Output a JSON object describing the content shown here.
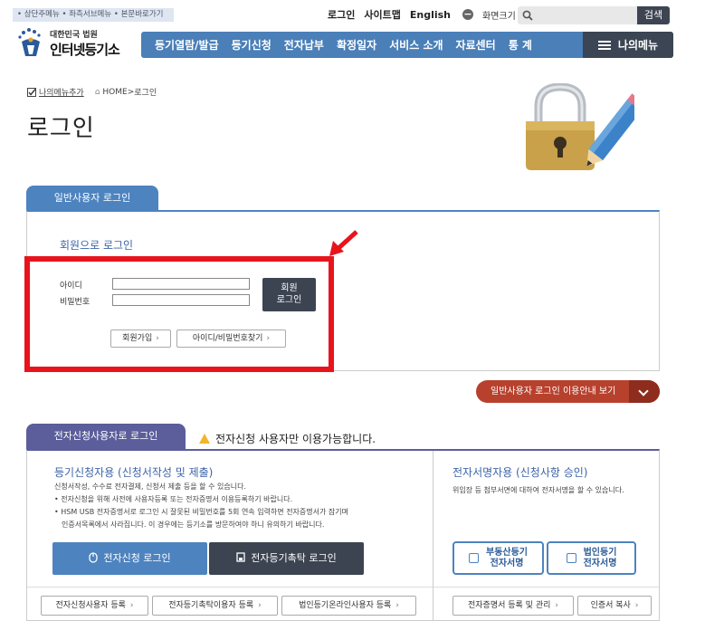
{
  "skip_links": "• 상단주메뉴 • 좌측서브메뉴 • 본문바로가기",
  "util": {
    "login": "로그인",
    "sitemap": "사이트맵",
    "english": "English",
    "zoom_label": "화면크기",
    "zoom_minus": "−",
    "zoom_plus": "+"
  },
  "search": {
    "placeholder": "",
    "button": "검색"
  },
  "logo": {
    "line1": "대한민국 법원",
    "line2": "인터넷등기소"
  },
  "nav": {
    "items": [
      "등기열람/발급",
      "등기신청",
      "전자납부",
      "확정일자",
      "서비스 소개",
      "자료센터",
      "통 계"
    ],
    "my_menu": "나의메뉴"
  },
  "breadcrumb": {
    "add_menu": "나의메뉴추가",
    "home": "HOME",
    "sep": ">",
    "current": "로그인"
  },
  "page_title": "로그인",
  "general_login": {
    "tab": "일반사용자 로그인",
    "member_title": "회원으로 로그인",
    "id_label": "아이디",
    "pw_label": "비밀번호",
    "id_value": "",
    "pw_value": "",
    "login_button_line1": "회원",
    "login_button_line2": "로그인",
    "signup": "회원가입",
    "find": "아이디/비밀번호찾기",
    "guide": "일반사용자 로그인 이용안내 보기"
  },
  "e_login": {
    "tab": "전자신청사용자로 로그인",
    "notice": "전자신청 사용자만 이용가능합니다.",
    "left_title": "등기신청자용 (신청서작성 및 제출)",
    "left_desc": [
      "신청서작성, 수수료 전자결제, 신청서 제출 등을 할 수 있습니다.",
      "• 전자신청을 위해 사전에 사용자등록 또는 전자증명서 이용등록하기 바랍니다.",
      "• HSM USB 전자증명서로 로그인 시 잘못된 비밀번호를 5회 연속 입력하면 전자증명서가 잠기며",
      "  인증서목록에서 사라집니다. 이 경우에는 등기소를 방문하여야 하니 유의하기 바랍니다."
    ],
    "btn_e_login": "전자신청 로그인",
    "btn_trust_login": "전자등기촉탁 로그인",
    "right_title": "전자서명자용 (신청사항 승인)",
    "right_desc": "위임장 등 첨부서면에 대하여 전자서명을 할 수 있습니다.",
    "btn_realestate_1": "부동산등기",
    "btn_realestate_2": "전자서명",
    "btn_corp_1": "법인등기",
    "btn_corp_2": "전자서명",
    "bottom": [
      "전자신청사용자 등록",
      "전자등기촉탁이용자 등록",
      "법인등기온라인사용자 등록",
      "전자증명서 등록 및 관리",
      "인증서 복사"
    ]
  },
  "colors": {
    "nav_blue": "#4a7fb8",
    "dark": "#3c4451",
    "annotation_red": "#e8141c",
    "guide_red": "#b8412e",
    "tab_purple": "#5b5e9a"
  }
}
